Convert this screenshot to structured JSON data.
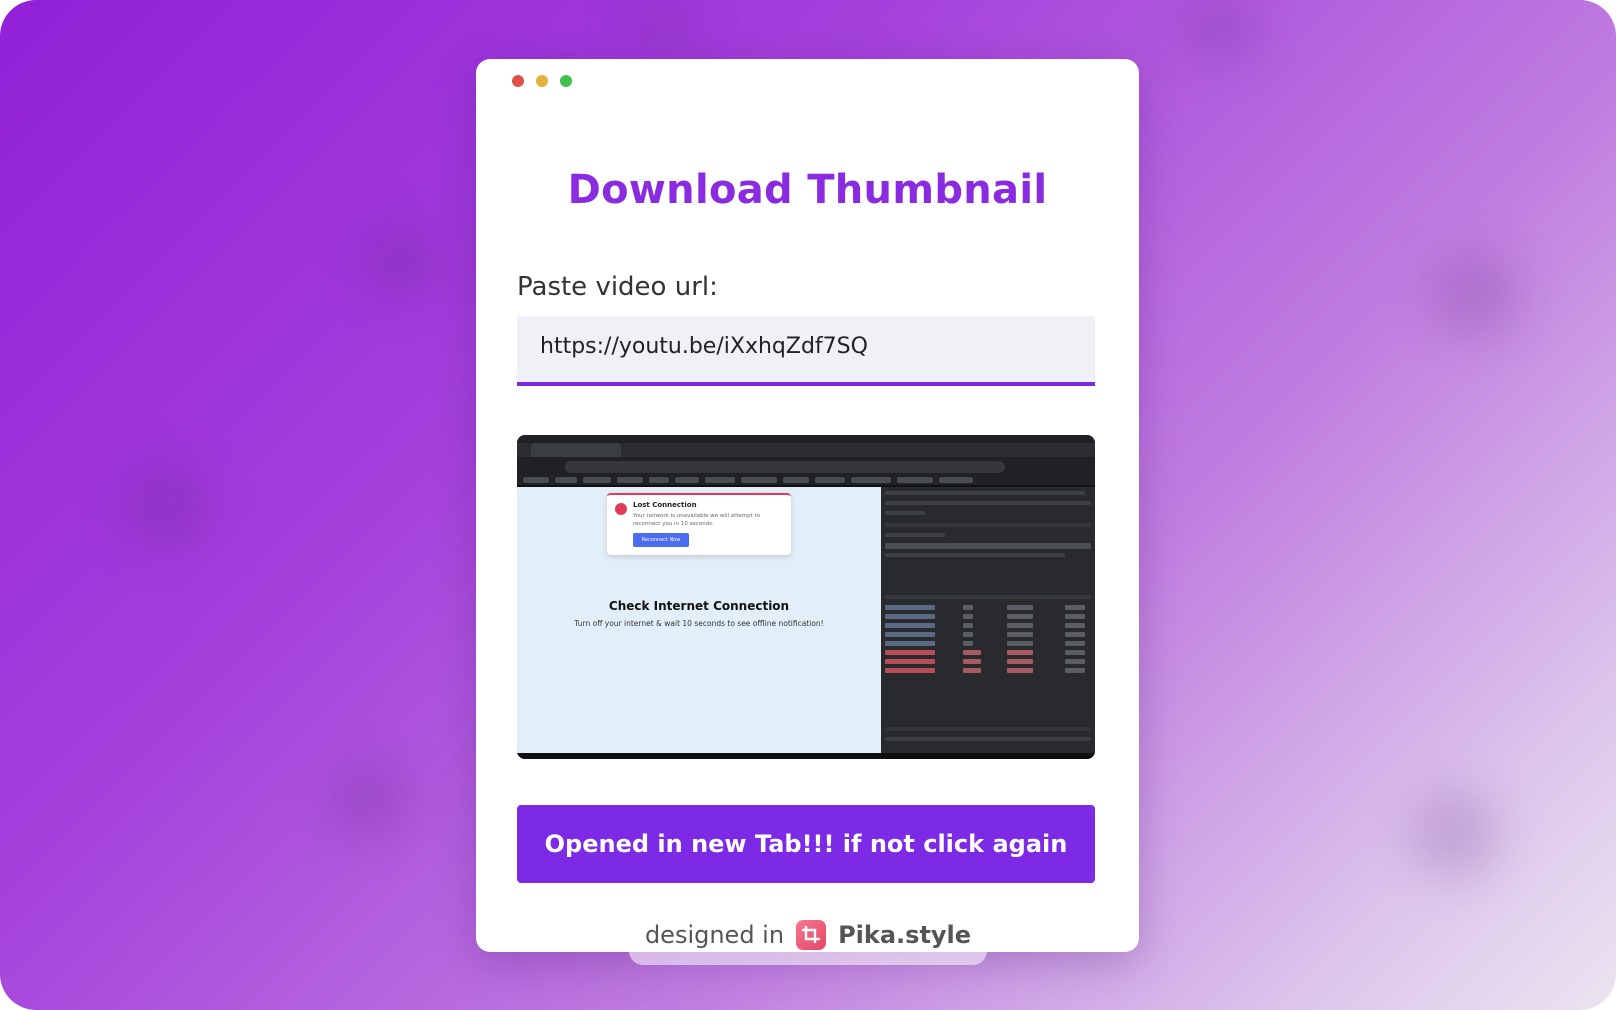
{
  "colors": {
    "accent": "#7c2ae6",
    "title": "#8a2be2",
    "traffic_red": "#e0504a",
    "traffic_yellow": "#e7b03a",
    "traffic_green": "#3fbf4b"
  },
  "app": {
    "title": "Download Thumbnail",
    "url_label": "Paste video url:",
    "url_value": "https://youtu.be/iXxhqZdf7SQ",
    "action_button": "Opened in new Tab!!! if not click again"
  },
  "thumbnail": {
    "popup_title": "Lost Connection",
    "popup_text": "Your network is unavailable we will attempt to reconnect you in 10 seconds.",
    "popup_button": "Reconnect Now",
    "heading": "Check Internet Connection",
    "subtext": "Turn off your internet & wait 10 seconds to see offline notification!"
  },
  "footer": {
    "designed_in": "designed in",
    "brand": "Pika.style",
    "brand_icon": "crop-icon"
  }
}
